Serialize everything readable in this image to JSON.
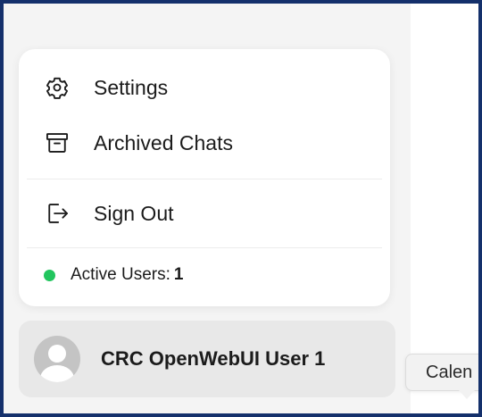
{
  "menu": {
    "items": [
      {
        "label": "Settings",
        "icon": "gear-icon"
      },
      {
        "label": "Archived Chats",
        "icon": "archive-box-icon"
      },
      {
        "label": "Sign Out",
        "icon": "sign-out-icon"
      }
    ],
    "active_users": {
      "label": "Active Users:",
      "count": "1",
      "status_color": "#22c55e"
    }
  },
  "user": {
    "name": "CRC OpenWebUI User 1",
    "avatar_icon": "user-avatar-icon"
  },
  "tooltip": {
    "text": "Calen"
  },
  "colors": {
    "frame_border": "#14306b",
    "sidebar_bg": "#f4f4f4",
    "menu_bg": "#ffffff",
    "user_row_bg": "#e8e8e8"
  }
}
